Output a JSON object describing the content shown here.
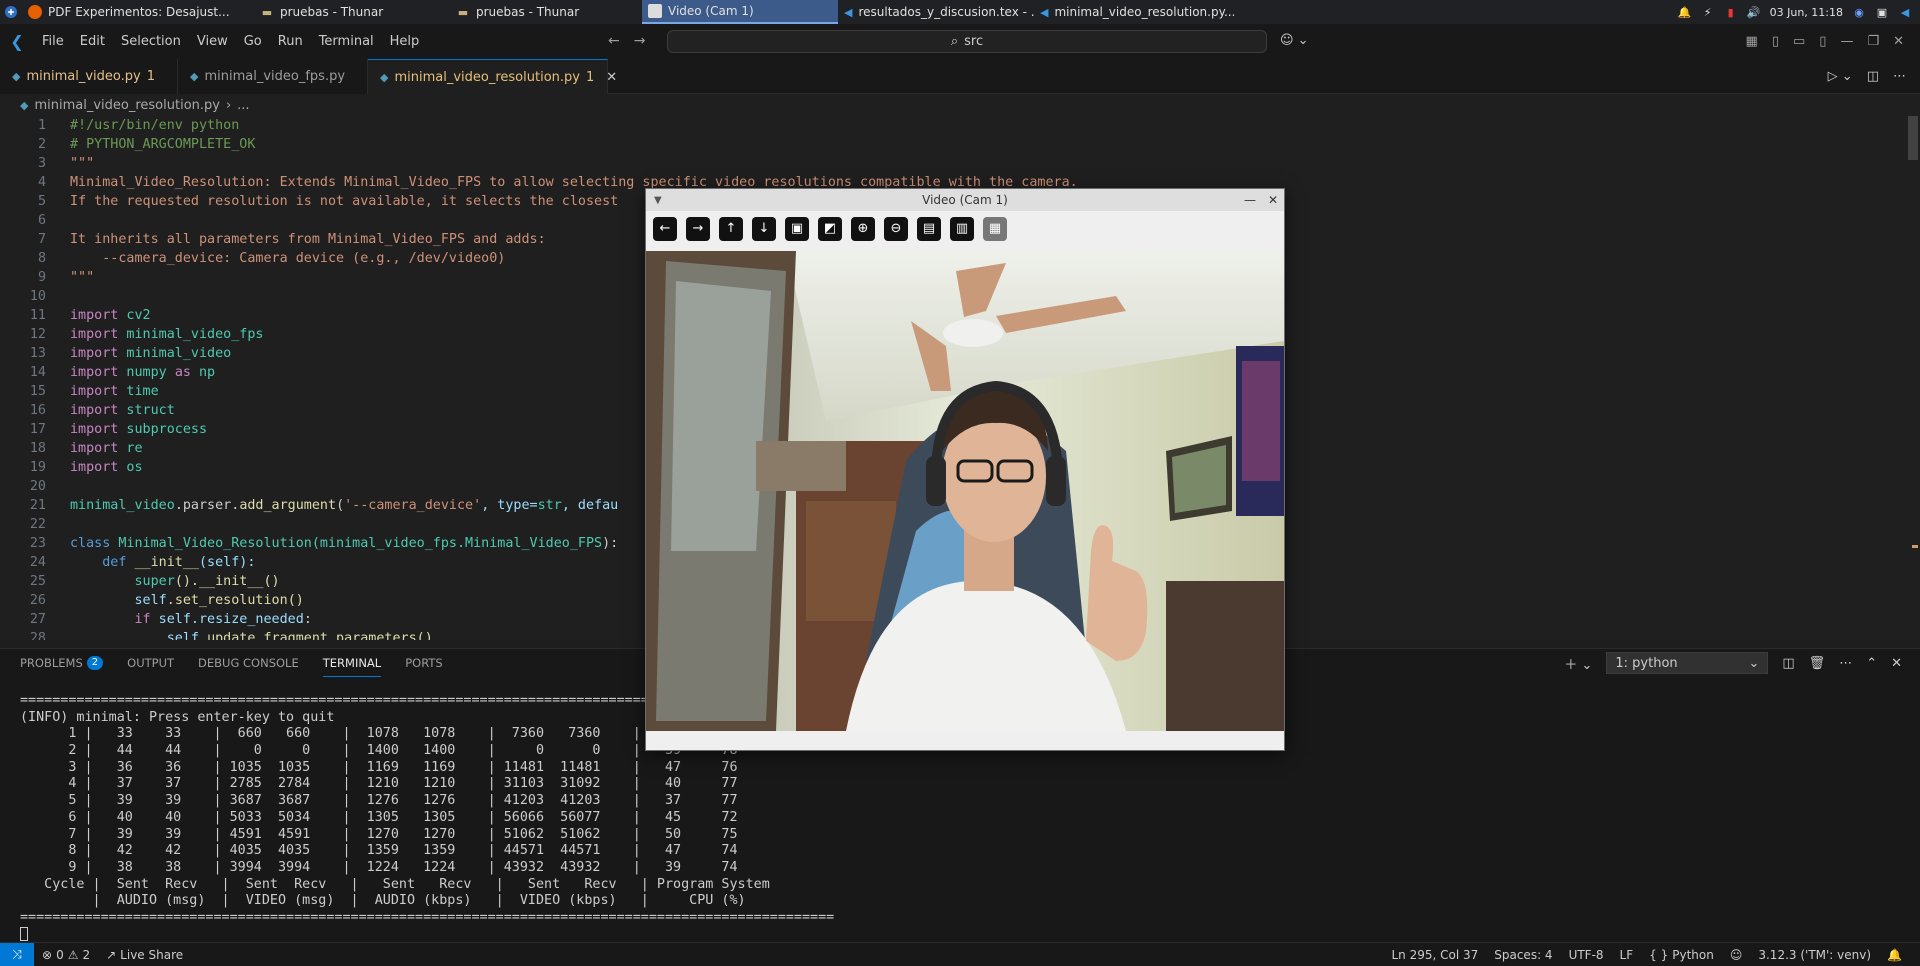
{
  "taskbar": {
    "tasks": [
      {
        "label": "PDF Experimentos: Desajust...",
        "icon": "firefox-icon"
      },
      {
        "label": "pruebas - Thunar",
        "icon": "folder-icon"
      },
      {
        "label": "pruebas - Thunar",
        "icon": "folder-icon"
      },
      {
        "label": "Video (Cam 1)",
        "icon": "window-icon"
      },
      {
        "label": "resultados_y_discusion.tex - ...",
        "icon": "vscode-icon"
      },
      {
        "label": "minimal_video_resolution.py...",
        "icon": "vscode-icon"
      }
    ],
    "clock": "03 Jun, 11:18"
  },
  "menubar": {
    "items": [
      "File",
      "Edit",
      "Selection",
      "View",
      "Go",
      "Run",
      "Terminal",
      "Help"
    ],
    "search_text": "src"
  },
  "tabs": [
    {
      "label": "minimal_video.py",
      "suffix": "1",
      "active": false
    },
    {
      "label": "minimal_video_fps.py",
      "suffix": "",
      "active": false
    },
    {
      "label": "minimal_video_resolution.py",
      "suffix": "1",
      "active": true
    }
  ],
  "breadcrumb": {
    "file": "minimal_video_resolution.py",
    "rest": "..."
  },
  "editor": {
    "lines": [
      {
        "n": "1",
        "text": "#!/usr/bin/env python"
      },
      {
        "n": "2",
        "text": "# PYTHON_ARGCOMPLETE_OK"
      },
      {
        "n": "3",
        "text": "\"\"\""
      },
      {
        "n": "4",
        "text": "Minimal_Video_Resolution: Extends Minimal_Video_FPS to allow selecting specific video resolutions compatible with the camera."
      },
      {
        "n": "5",
        "text": "If the requested resolution is not available, it selects the closest"
      },
      {
        "n": "6",
        "text": ""
      },
      {
        "n": "7",
        "text": "It inherits all parameters from Minimal_Video_FPS and adds:"
      },
      {
        "n": "8",
        "text": "    --camera_device: Camera device (e.g., /dev/video0)"
      },
      {
        "n": "9",
        "text": "\"\"\""
      },
      {
        "n": "10",
        "text": ""
      },
      {
        "n": "11",
        "kw": "import",
        "rest": " cv2"
      },
      {
        "n": "12",
        "kw": "import",
        "rest": " minimal_video_fps"
      },
      {
        "n": "13",
        "kw": "import",
        "rest": " minimal_video"
      },
      {
        "n": "14",
        "kw": "import",
        "rest": " numpy ",
        "kw2": "as",
        "rest2": " np"
      },
      {
        "n": "15",
        "kw": "import",
        "rest": " time"
      },
      {
        "n": "16",
        "kw": "import",
        "rest": " struct"
      },
      {
        "n": "17",
        "kw": "import",
        "rest": " subprocess"
      },
      {
        "n": "18",
        "kw": "import",
        "rest": " re"
      },
      {
        "n": "19",
        "kw": "import",
        "rest": " os"
      },
      {
        "n": "20",
        "text": ""
      },
      {
        "n": "21",
        "a": "minimal_video",
        "b": ".parser.",
        "c": "add_argument",
        "d": "(",
        "e": "'--camera_device'",
        "f": ", type=",
        "g": "str",
        "h": ", defau"
      },
      {
        "n": "22",
        "text": ""
      },
      {
        "n": "23",
        "a": "class",
        "b": " ",
        "c": "Minimal_Video_Resolution",
        "d": "(minimal_video_fps.",
        "e": "Minimal_Video_FPS",
        "f": "):"
      },
      {
        "n": "24",
        "a": "    def",
        "b": " ",
        "c": "__init__",
        "d": "(self):"
      },
      {
        "n": "25",
        "a": "        super",
        "b": "().",
        "c": "__init__",
        "d": "()"
      },
      {
        "n": "26",
        "a": "        self",
        "b": ".",
        "c": "set_resolution",
        "d": "()"
      },
      {
        "n": "27",
        "a": "        if",
        "b": " self.",
        "c": "resize_needed",
        "d": ":"
      },
      {
        "n": "28",
        "a": "            self",
        "b": ".",
        "c": "update_fragment_parameters",
        "d": "()"
      }
    ]
  },
  "panel": {
    "tabs": [
      {
        "label": "PROBLEMS",
        "badge": "2"
      },
      {
        "label": "OUTPUT"
      },
      {
        "label": "DEBUG CONSOLE"
      },
      {
        "label": "TERMINAL",
        "active": true
      },
      {
        "label": "PORTS"
      }
    ],
    "terminal_select": "1: python",
    "terminal_lines": [
      "=====================================================================================================================",
      "(INFO) minimal: Press enter-key to quit",
      "      1 |   33    33    |  660   660    |  1078   1078    |  7360   7360    |   39     78",
      "      2 |   44    44    |    0     0    |  1400   1400    |     0      0    |   39     78",
      "      3 |   36    36    | 1035  1035    |  1169   1169    | 11481  11481    |   47     76",
      "      4 |   37    37    | 2785  2784    |  1210   1210    | 31103  31092    |   40     77",
      "      5 |   39    39    | 3687  3687    |  1276   1276    | 41203  41203    |   37     77",
      "      6 |   40    40    | 5033  5034    |  1305   1305    | 56066  56077    |   45     72",
      "      7 |   39    39    | 4591  4591    |  1270   1270    | 51062  51062    |   50     75",
      "      8 |   42    42    | 4035  4035    |  1359   1359    | 44571  44571    |   47     74",
      "      9 |   38    38    | 3994  3994    |  1224   1224    | 43932  43932    |   39     74",
      "   Cycle |  Sent  Recv   |  Sent  Recv   |   Sent   Recv   |   Sent   Recv   | Program System",
      "         |  AUDIO (msg)  |  VIDEO (msg)  |  AUDIO (kbps)   |  VIDEO (kbps)   |     CPU (%)",
      "====================================================================================================="
    ]
  },
  "statusbar": {
    "errors": "0",
    "warnings": "2",
    "live_share": "Live Share",
    "position": "Ln 295, Col 37",
    "spaces": "Spaces: 4",
    "encoding": "UTF-8",
    "eol": "LF",
    "language": "Python",
    "interpreter": "3.12.3 ('TM': venv)"
  },
  "video_window": {
    "title": "Video (Cam 1)"
  },
  "colors": {
    "accent": "#0078d4",
    "editor_bg": "#1f1f1f",
    "comment": "#6a9955",
    "string": "#ce9178",
    "keyword": "#c586c0"
  }
}
